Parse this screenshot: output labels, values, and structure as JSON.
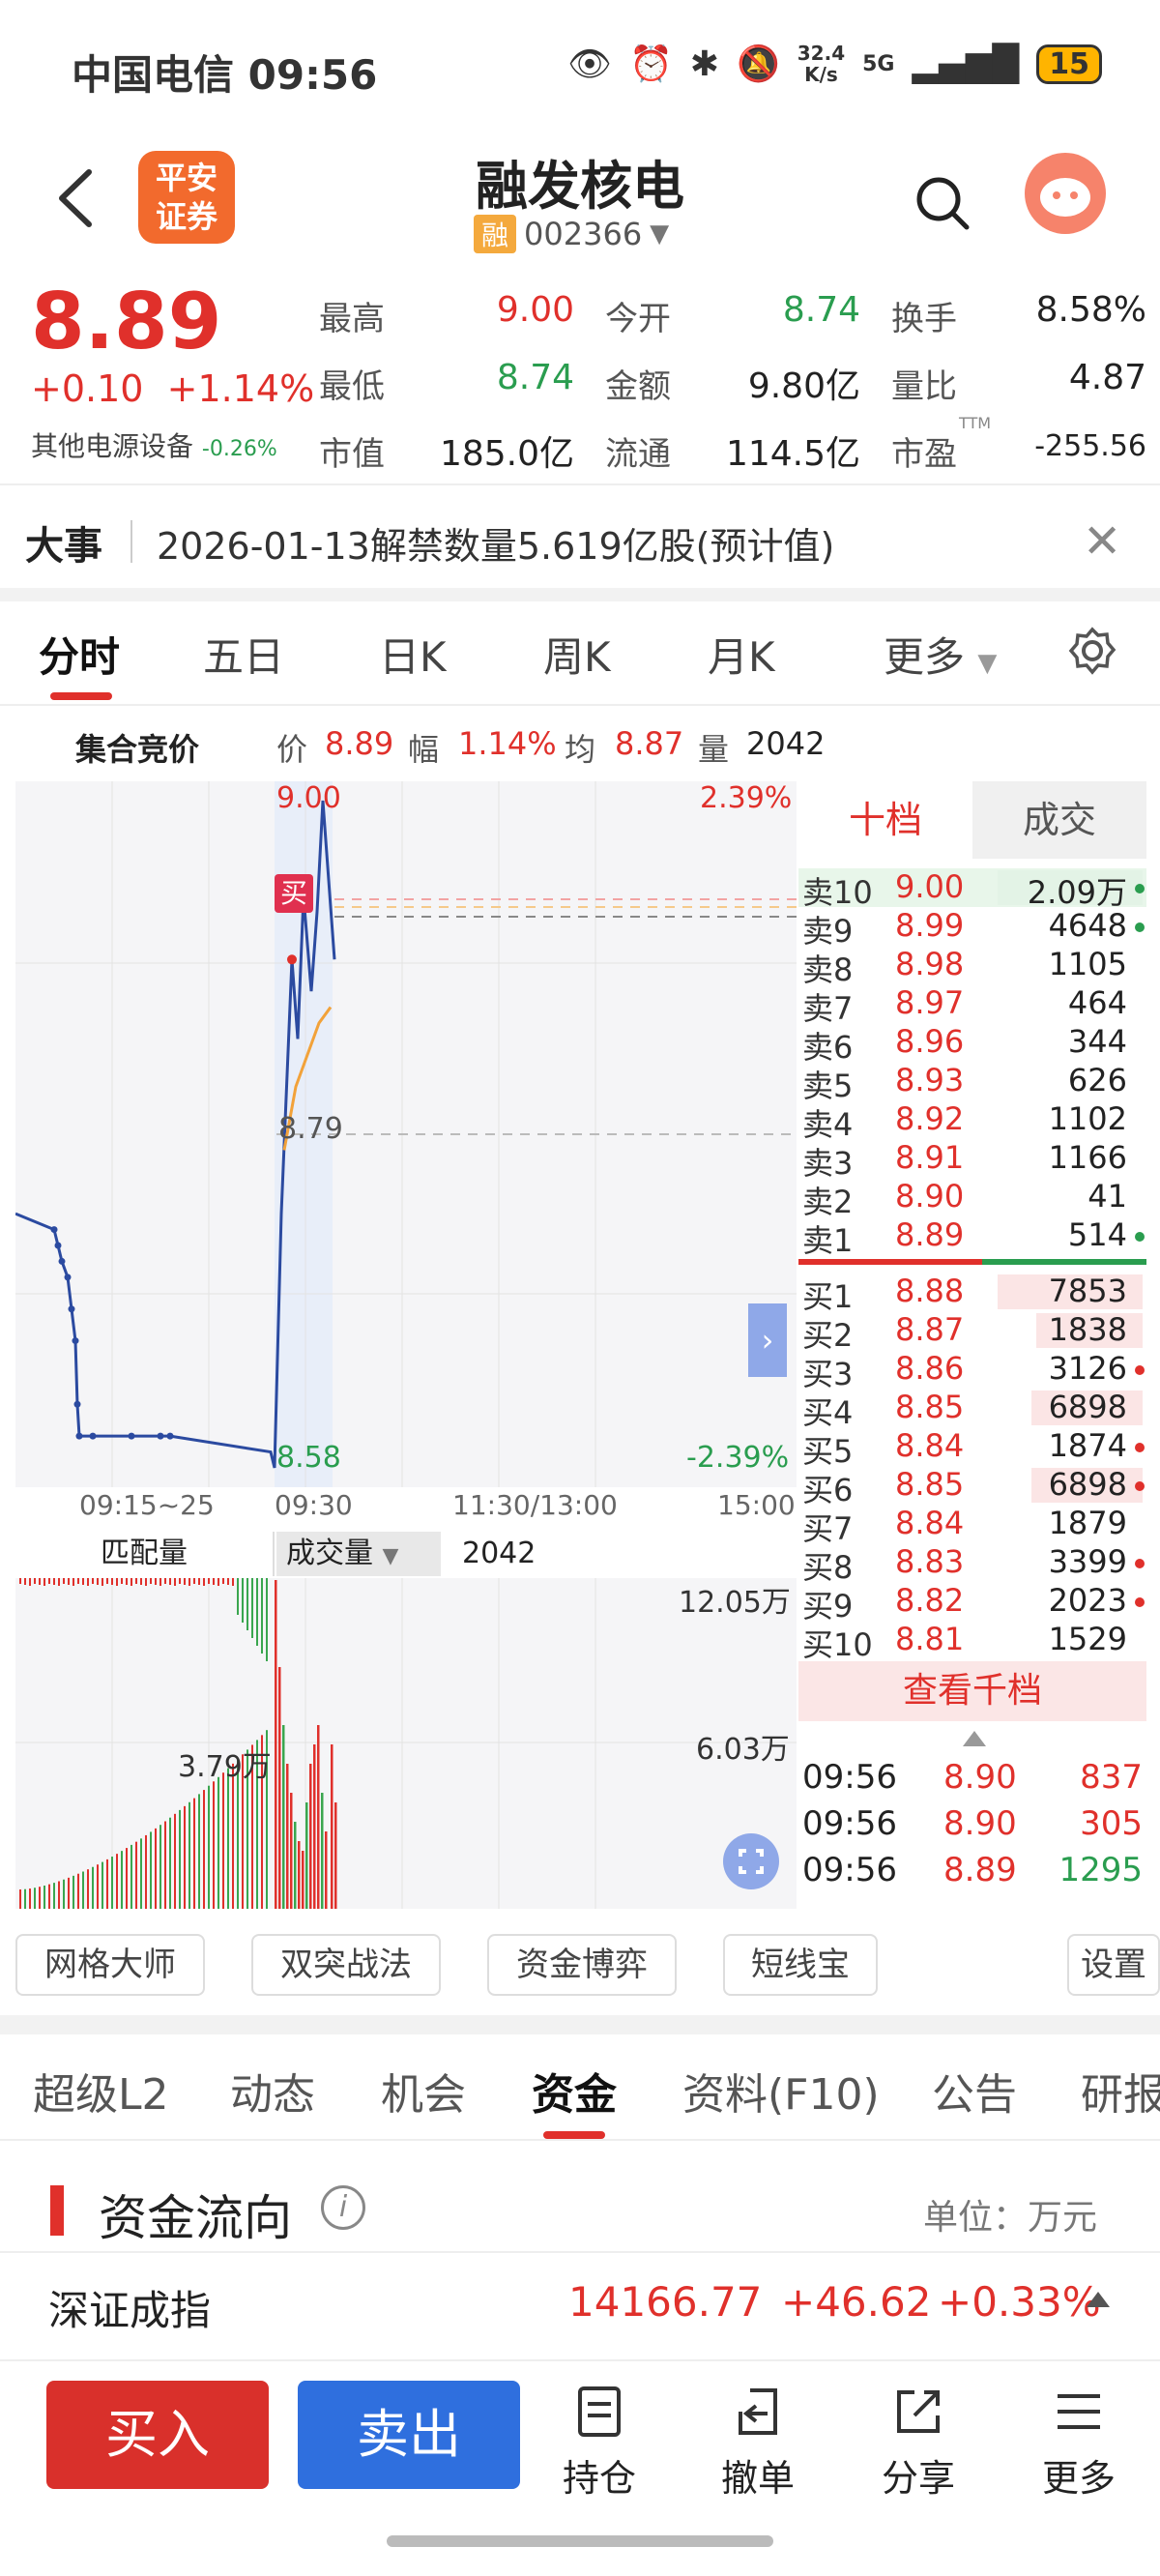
{
  "status_bar": {
    "carrier_time": "中国电信 09:56",
    "net_speed_value": "32.4",
    "net_speed_unit": "K/s",
    "network": "5G",
    "battery": "15"
  },
  "header": {
    "logo_line1": "平安",
    "logo_line2": "证券",
    "stock_name": "融发核电",
    "margin_badge": "融",
    "stock_code": "002366"
  },
  "quote": {
    "price": "8.89",
    "change": "+0.10",
    "change_pct": "+1.14%",
    "sector": "其他电源设备",
    "sector_pct": "-0.26%",
    "high_label": "最高",
    "high": "9.00",
    "low_label": "最低",
    "low": "8.74",
    "mcap_label": "市值",
    "mcap": "185.0亿",
    "open_label": "今开",
    "open": "8.74",
    "amount_label": "金额",
    "amount": "9.80亿",
    "float_label": "流通",
    "float": "114.5亿",
    "turnover_label": "换手",
    "turnover": "8.58%",
    "vol_ratio_label": "量比",
    "vol_ratio": "4.87",
    "pe_label": "市盈",
    "pe_sup": "TTM",
    "pe": "-255.56"
  },
  "event": {
    "tag": "大事",
    "text": "2026-01-13解禁数量5.619亿股(预计值)"
  },
  "chart_tabs": [
    "分时",
    "五日",
    "日K",
    "周K",
    "月K",
    "更多"
  ],
  "summary": {
    "label": "集合竞价",
    "price_label": "价",
    "price": "8.89",
    "amp_label": "幅",
    "amp": "1.14%",
    "avg_label": "均",
    "avg": "8.87",
    "vol_label": "量",
    "vol": "2042"
  },
  "chart": {
    "top_price": "9.00",
    "top_pct": "2.39%",
    "mid_price": "8.79",
    "bottom_price": "8.58",
    "bottom_pct": "-2.39%",
    "buy_marker": "买",
    "time_labels": [
      "09:15~25",
      "09:30",
      "11:30/13:00",
      "15:00"
    ]
  },
  "chart_data": {
    "type": "line",
    "title": "",
    "xlabel": "",
    "ylabel": "",
    "ylim": [
      8.58,
      9.0
    ],
    "prev_close": 8.79,
    "series": [
      {
        "values": [
          8.74,
          8.74,
          8.73,
          8.72,
          8.71,
          8.7,
          8.68,
          8.66,
          8.62,
          8.6,
          8.6,
          8.6,
          8.6,
          8.6,
          8.59,
          8.58,
          8.74,
          8.9,
          8.85,
          8.94,
          8.88,
          8.93,
          9.0,
          8.9
        ]
      },
      {
        "values": [
          8.78,
          8.82,
          8.84,
          8.86,
          8.87
        ]
      }
    ]
  },
  "order_book": {
    "tab_active": "十档",
    "tab_inactive": "成交",
    "asks": [
      {
        "label": "卖10",
        "price": "9.00",
        "vol": "2.09万"
      },
      {
        "label": "卖9",
        "price": "8.99",
        "vol": "4648"
      },
      {
        "label": "卖8",
        "price": "8.98",
        "vol": "1105"
      },
      {
        "label": "卖7",
        "price": "8.97",
        "vol": "464"
      },
      {
        "label": "卖6",
        "price": "8.96",
        "vol": "344"
      },
      {
        "label": "卖5",
        "price": "8.93",
        "vol": "626"
      },
      {
        "label": "卖4",
        "price": "8.92",
        "vol": "1102"
      },
      {
        "label": "卖3",
        "price": "8.91",
        "vol": "1166"
      },
      {
        "label": "卖2",
        "price": "8.90",
        "vol": "41"
      },
      {
        "label": "卖1",
        "price": "8.89",
        "vol": "514"
      }
    ],
    "bids": [
      {
        "label": "买1",
        "price": "8.88",
        "vol": "7853"
      },
      {
        "label": "买2",
        "price": "8.87",
        "vol": "1838"
      },
      {
        "label": "买3",
        "price": "8.86",
        "vol": "3126"
      },
      {
        "label": "买4",
        "price": "8.85",
        "vol": "6898"
      },
      {
        "label": "买5",
        "price": "8.84",
        "vol": "1874"
      },
      {
        "label": "买6",
        "price": "8.85",
        "vol": "6898"
      },
      {
        "label": "买7",
        "price": "8.84",
        "vol": "1879"
      },
      {
        "label": "买8",
        "price": "8.83",
        "vol": "3399"
      },
      {
        "label": "买9",
        "price": "8.82",
        "vol": "2023"
      },
      {
        "label": "买10",
        "price": "8.81",
        "vol": "1529"
      }
    ],
    "view_more": "查看千档",
    "ticks": [
      {
        "time": "09:56",
        "price": "8.90",
        "vol": "837"
      },
      {
        "time": "09:56",
        "price": "8.90",
        "vol": "305"
      },
      {
        "time": "09:56",
        "price": "8.89",
        "vol": "1295"
      }
    ]
  },
  "volume": {
    "left_label": "匹配量",
    "dropdown": "成交量",
    "value": "2042",
    "top_label": "12.05万",
    "mid_label": "6.03万",
    "annotation": "3.79万"
  },
  "tools": [
    "网格大师",
    "双突战法",
    "资金博弈",
    "短线宝",
    "设置"
  ],
  "sub_tabs": [
    "超级L2",
    "动态",
    "机会",
    "资金",
    "资料(F10)",
    "公告",
    "研报"
  ],
  "fund_flow": {
    "title": "资金流向",
    "unit": "单位：万元"
  },
  "index": {
    "name": "深证成指",
    "value": "14166.77",
    "change": "+46.62",
    "pct": "+0.33%"
  },
  "actions": {
    "buy": "买入",
    "sell": "卖出",
    "position": "持仓",
    "cancel": "撤单",
    "share": "分享",
    "more": "更多"
  }
}
